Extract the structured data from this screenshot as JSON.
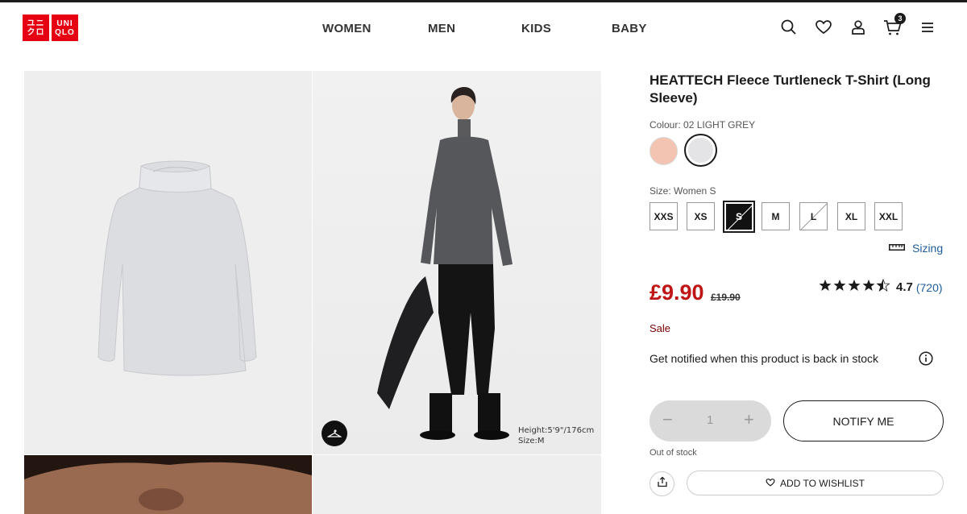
{
  "header": {
    "logo_top": "ユニクロ",
    "logo_bottom": "UNIQLO",
    "logo_box1_line1": "ユニ",
    "logo_box1_line2": "クロ",
    "logo_box2_line1": "UNI",
    "logo_box2_line2": "QLO",
    "nav": [
      "WOMEN",
      "MEN",
      "KIDS",
      "BABY"
    ],
    "cart_count": "3",
    "icons": [
      "search-icon",
      "heart-icon",
      "user-icon",
      "cart-icon",
      "menu-icon"
    ]
  },
  "gallery": {
    "model_height": "Height:5'9\"/176cm",
    "model_size": "Size:M"
  },
  "product": {
    "title": "HEATTECH Fleece Turtleneck T-Shirt (Long Sleeve)",
    "colour_label": "Colour: 02 LIGHT GREY",
    "swatches": [
      {
        "name": "pink",
        "color": "#f2c4b1"
      },
      {
        "name": "light-grey",
        "color": "#e4e4e6",
        "selected": true
      }
    ],
    "size_label": "Size: Women S",
    "sizes": [
      {
        "label": "XXS",
        "state": "available"
      },
      {
        "label": "XS",
        "state": "available"
      },
      {
        "label": "S",
        "state": "selected"
      },
      {
        "label": "M",
        "state": "available"
      },
      {
        "label": "L",
        "state": "unavailable"
      },
      {
        "label": "XL",
        "state": "available"
      },
      {
        "label": "XXL",
        "state": "available"
      }
    ],
    "sizing_link": "Sizing",
    "price": "£9.90",
    "old_price": "£19.90",
    "rating_stars": 4.5,
    "rating_value": "4.7",
    "rating_count": "(720)",
    "sale_label": "Sale",
    "notify_text": "Get notified when this product is back in stock",
    "quantity": "1",
    "qty_minus": "−",
    "qty_plus": "+",
    "notify_button": "NOTIFY ME",
    "stock_status": "Out of stock",
    "wishlist_button": "ADD TO WISHLIST"
  },
  "colors": {
    "brand_red": "#e60012",
    "price_red": "#c01515",
    "link_blue": "#1f5c9a"
  }
}
